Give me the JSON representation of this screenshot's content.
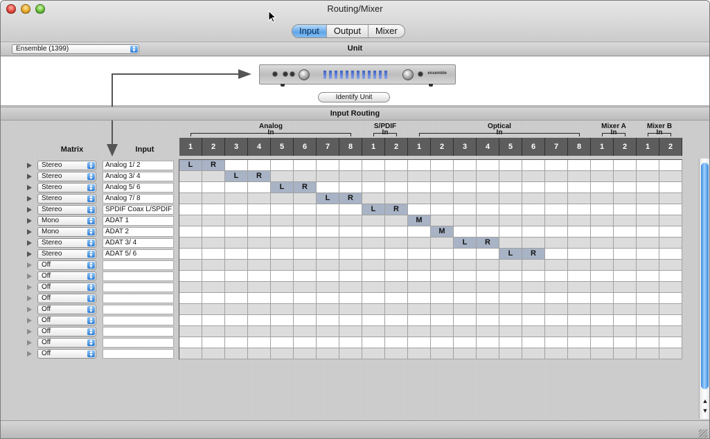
{
  "window": {
    "title": "Routing/Mixer"
  },
  "tabs": [
    {
      "label": "Input",
      "active": true
    },
    {
      "label": "Output",
      "active": false
    },
    {
      "label": "Mixer",
      "active": false
    }
  ],
  "unit": {
    "section_label": "Unit",
    "selected": "Ensemble (1399)",
    "identify_label": "Identify Unit",
    "device_brand": "ensemble"
  },
  "routing": {
    "section_label": "Input Routing",
    "matrix_header": "Matrix",
    "input_header": "Input",
    "groups": [
      {
        "name": "Analog",
        "sub": "In",
        "channels": [
          "1",
          "2",
          "3",
          "4",
          "5",
          "6",
          "7",
          "8"
        ]
      },
      {
        "name": "S/PDIF",
        "sub": "In",
        "channels": [
          "1",
          "2"
        ]
      },
      {
        "name": "Optical",
        "sub": "In",
        "channels": [
          "1",
          "2",
          "3",
          "4",
          "5",
          "6",
          "7",
          "8"
        ]
      },
      {
        "name": "Mixer A",
        "sub": "In",
        "channels": [
          "1",
          "2"
        ]
      },
      {
        "name": "Mixer B",
        "sub": "In",
        "channels": [
          "1",
          "2"
        ]
      }
    ],
    "rows": [
      {
        "mode": "Stereo",
        "input": "Analog 1/ 2",
        "routes": [
          [
            0,
            "L"
          ],
          [
            1,
            "R"
          ]
        ]
      },
      {
        "mode": "Stereo",
        "input": "Analog 3/ 4",
        "routes": [
          [
            2,
            "L"
          ],
          [
            3,
            "R"
          ]
        ]
      },
      {
        "mode": "Stereo",
        "input": "Analog 5/ 6",
        "routes": [
          [
            4,
            "L"
          ],
          [
            5,
            "R"
          ]
        ]
      },
      {
        "mode": "Stereo",
        "input": "Analog 7/ 8",
        "routes": [
          [
            6,
            "L"
          ],
          [
            7,
            "R"
          ]
        ]
      },
      {
        "mode": "Stereo",
        "input": "SPDIF Coax L/SPDIF Coax R",
        "routes": [
          [
            8,
            "L"
          ],
          [
            9,
            "R"
          ]
        ]
      },
      {
        "mode": "Mono",
        "input": "ADAT 1",
        "routes": [
          [
            10,
            "M"
          ]
        ]
      },
      {
        "mode": "Mono",
        "input": "ADAT 2",
        "routes": [
          [
            11,
            "M"
          ]
        ]
      },
      {
        "mode": "Stereo",
        "input": "ADAT 3/ 4",
        "routes": [
          [
            12,
            "L"
          ],
          [
            13,
            "R"
          ]
        ]
      },
      {
        "mode": "Stereo",
        "input": "ADAT 5/ 6",
        "routes": [
          [
            14,
            "L"
          ],
          [
            15,
            "R"
          ]
        ]
      },
      {
        "mode": "Off",
        "input": "",
        "routes": []
      },
      {
        "mode": "Off",
        "input": "",
        "routes": []
      },
      {
        "mode": "Off",
        "input": "",
        "routes": []
      },
      {
        "mode": "Off",
        "input": "",
        "routes": []
      },
      {
        "mode": "Off",
        "input": "",
        "routes": []
      },
      {
        "mode": "Off",
        "input": "",
        "routes": []
      },
      {
        "mode": "Off",
        "input": "",
        "routes": []
      },
      {
        "mode": "Off",
        "input": "",
        "routes": []
      },
      {
        "mode": "Off",
        "input": "",
        "routes": []
      }
    ]
  },
  "colors": {
    "route_cell": "#a8b3c5",
    "header_bg": "#5d5d5d",
    "tab_active": "#5fa6e8",
    "scroll_thumb": "#3a89dc"
  }
}
